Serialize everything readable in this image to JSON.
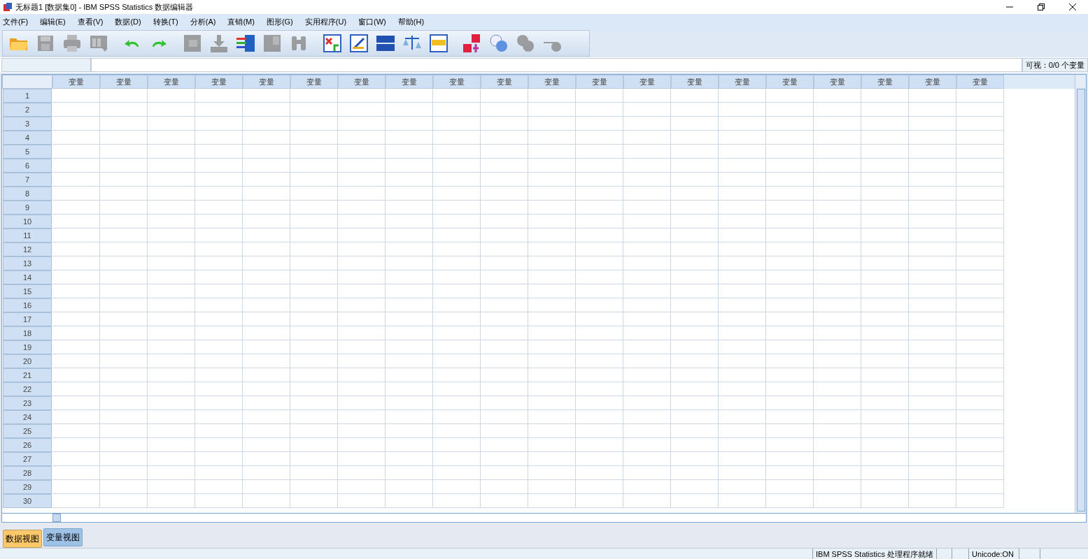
{
  "window": {
    "title": "无标题1 [数据集0] - IBM SPSS Statistics 数据编辑器"
  },
  "menu": [
    "文件(F)",
    "编辑(E)",
    "查看(V)",
    "数据(D)",
    "转换(T)",
    "分析(A)",
    "直销(M)",
    "图形(G)",
    "实用程序(U)",
    "窗口(W)",
    "帮助(H)"
  ],
  "toolbar": [
    {
      "kind": "open",
      "disabled": false
    },
    {
      "kind": "save",
      "disabled": true
    },
    {
      "kind": "print",
      "disabled": true
    },
    {
      "kind": "recall",
      "disabled": true
    },
    {
      "kind": "undo",
      "disabled": false
    },
    {
      "kind": "redo",
      "disabled": false
    },
    {
      "kind": "gotocase",
      "disabled": true
    },
    {
      "kind": "gotovar",
      "disabled": true
    },
    {
      "kind": "variables",
      "disabled": false
    },
    {
      "kind": "stats",
      "disabled": true
    },
    {
      "kind": "find",
      "disabled": true
    },
    {
      "kind": "insertcase",
      "disabled": false
    },
    {
      "kind": "insertvar",
      "disabled": false
    },
    {
      "kind": "split",
      "disabled": false
    },
    {
      "kind": "weight",
      "disabled": false
    },
    {
      "kind": "select",
      "disabled": false
    },
    {
      "kind": "labels",
      "disabled": false
    },
    {
      "kind": "sets",
      "disabled": false
    },
    {
      "kind": "showall",
      "disabled": true
    },
    {
      "kind": "spell",
      "disabled": true
    }
  ],
  "visible_info": "可视：0/0 个变量",
  "grid": {
    "columns": [
      "变量",
      "变量",
      "变量",
      "变量",
      "变量",
      "变量",
      "变量",
      "变量",
      "变量",
      "变量",
      "变量",
      "变量",
      "变量",
      "变量",
      "变量",
      "变量",
      "变量",
      "变量",
      "变量",
      "变量"
    ],
    "rows": [
      "1",
      "2",
      "3",
      "4",
      "5",
      "6",
      "7",
      "8",
      "9",
      "10",
      "11",
      "12",
      "13",
      "14",
      "15",
      "16",
      "17",
      "18",
      "19",
      "20",
      "21",
      "22",
      "23",
      "24",
      "25",
      "26",
      "27",
      "28",
      "29",
      "30"
    ]
  },
  "view_tabs": [
    {
      "label": "数据视图",
      "selected": true
    },
    {
      "label": "变量视图",
      "selected": false
    }
  ],
  "status_bar": [
    "IBM SPSS Statistics 处理程序就绪",
    "Unicode:ON"
  ]
}
